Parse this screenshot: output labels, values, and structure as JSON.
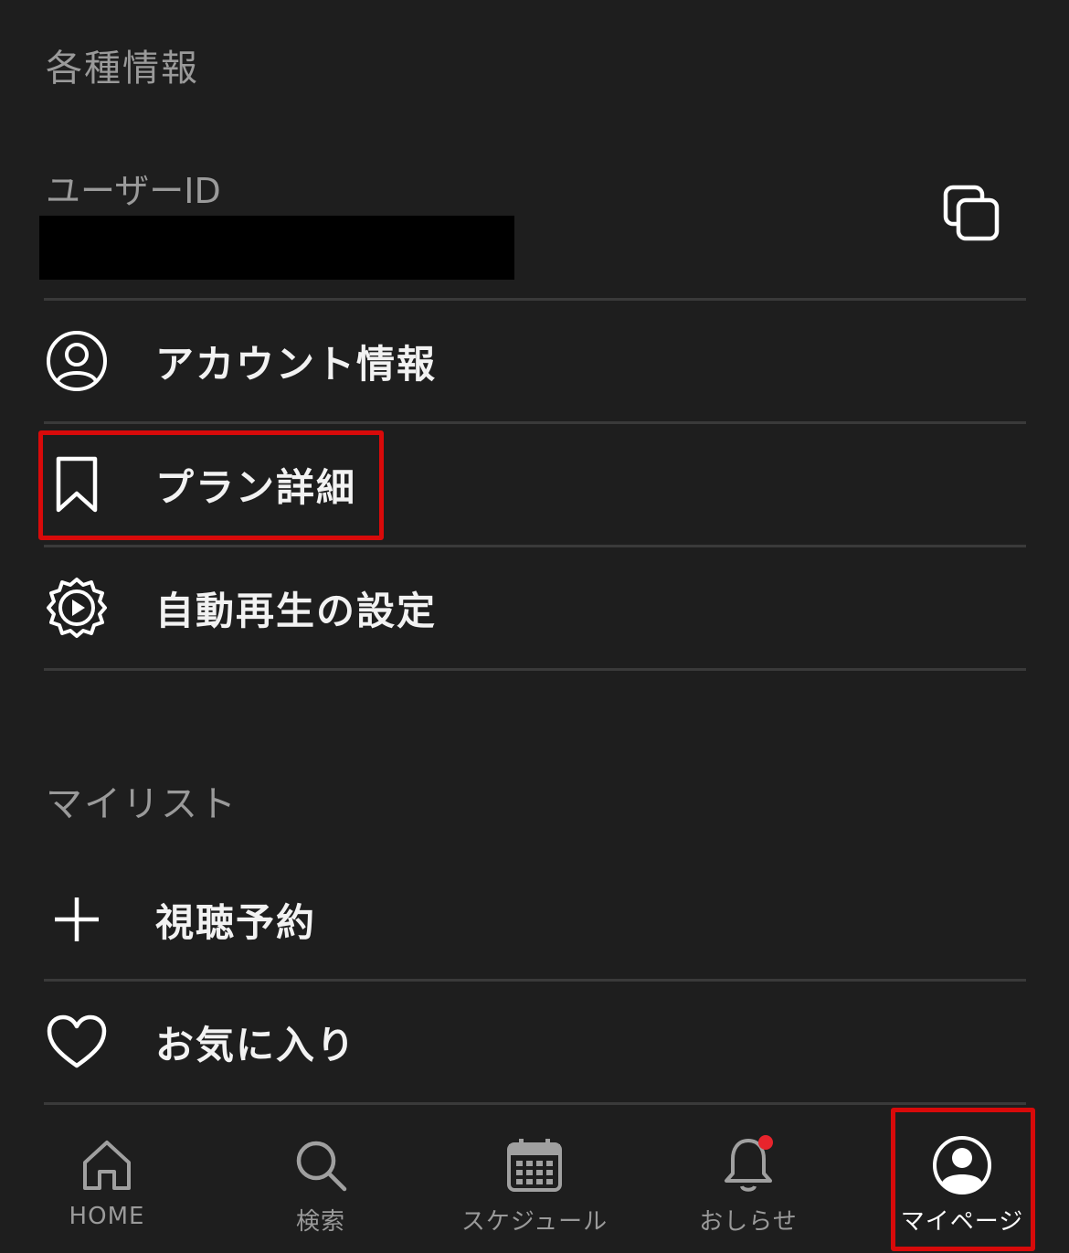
{
  "sections": {
    "info_title": "各種情報",
    "mylist_title": "マイリスト"
  },
  "user_id": {
    "label": "ユーザーID",
    "value": ""
  },
  "menu": {
    "account": "アカウント情報",
    "plan": "プラン詳細",
    "autoplay": "自動再生の設定",
    "reserve": "視聴予約",
    "favorites": "お気に入り"
  },
  "tabbar": {
    "home": "HOME",
    "search": "検索",
    "schedule": "スケジュール",
    "notices": "おしらせ",
    "mypage": "マイページ",
    "active": "mypage",
    "notification_badge": true
  },
  "colors": {
    "background": "#1e1e1e",
    "highlight": "#d80a0a",
    "badge": "#e8242c",
    "muted_text": "#9a9a9a"
  },
  "icons": [
    "copy-icon",
    "account-circle-icon",
    "bookmark-icon",
    "gear-play-icon",
    "plus-icon",
    "heart-icon",
    "home-icon",
    "search-icon",
    "calendar-icon",
    "bell-icon",
    "user-avatar-icon"
  ]
}
